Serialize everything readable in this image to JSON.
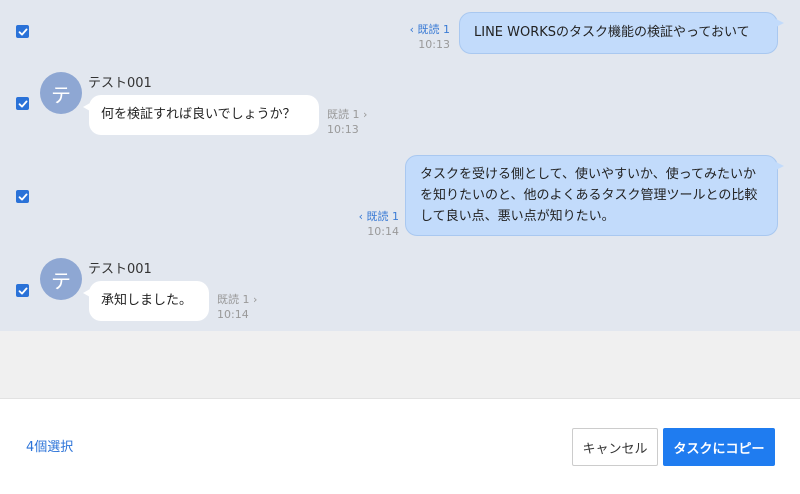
{
  "messages": [
    {
      "direction": "out",
      "checked": true,
      "text": "LINE WORKSのタスク機能の検証やっておいて",
      "read_label": "既読 1",
      "time": "10:13"
    },
    {
      "direction": "in",
      "checked": true,
      "avatar_initial": "テ",
      "sender": "テスト001",
      "text": "何を検証すれば良いでしょうか？",
      "read_label": "既読 1",
      "time": "10:13"
    },
    {
      "direction": "out",
      "checked": true,
      "text": "タスクを受ける側として、使いやすいか、使ってみたいかを知りたいのと、他のよくあるタスク管理ツールとの比較して良い点、悪い点が知りたい。",
      "read_label": "既読 1",
      "time": "10:14"
    },
    {
      "direction": "in",
      "checked": true,
      "avatar_initial": "テ",
      "sender": "テスト001",
      "text": "承知しました。",
      "read_label": "既読 1",
      "time": "10:14"
    }
  ],
  "footer": {
    "selected_count": "4個選択",
    "cancel_label": "キャンセル",
    "copy_label": "タスクにコピー"
  },
  "colors": {
    "chat_background": "#e2e7ef",
    "outgoing_bubble": "#c2dbfb",
    "incoming_bubble": "#ffffff",
    "accent": "#1f7cf0",
    "avatar": "#8ea7d3"
  }
}
